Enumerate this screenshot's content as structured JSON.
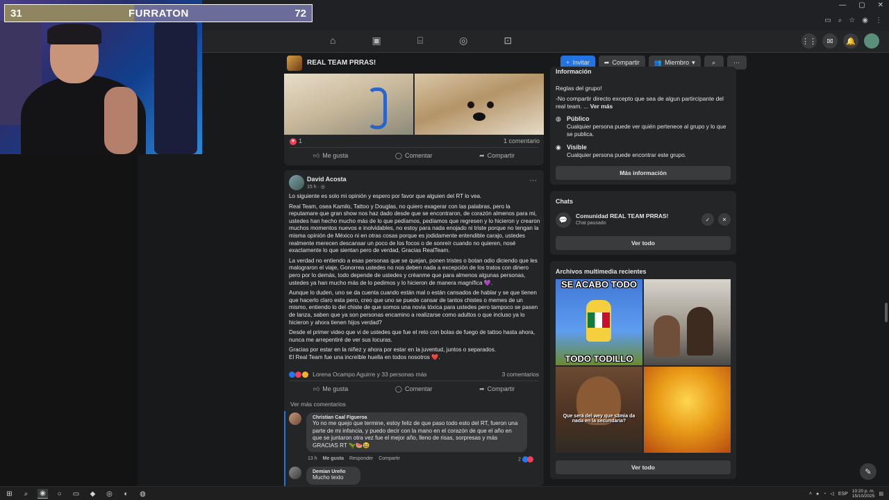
{
  "stream_overlay": {
    "left_score": "31",
    "title": "FURRATON",
    "right_score": "72"
  },
  "browser": {
    "window_controls": [
      "—",
      "▢",
      "✕"
    ]
  },
  "group": {
    "name": "REAL TEAM PRRAS!",
    "invite_label": "Invitar",
    "share_label": "Compartir",
    "member_label": "Miembro"
  },
  "post1": {
    "reaction_count": "1",
    "comments_count": "1 comentario",
    "like_label": "Me gusta",
    "comment_label": "Comentar",
    "share_label": "Compartir"
  },
  "post2": {
    "author": "David Acosta",
    "time": "15 h · ",
    "paragraphs": [
      "Lo siguiente es solo mi opinión y espero por favor que alguien del RT lo vea.",
      "Real Team, osea Kamilo, Tattoo y Douglas, no quiero exagerar con las palabras, pero la reputamare que gran show nos haz dado desde que se encontraron, de corazón almenos para mi, ustedes han hecho mucho más de lo que pedíamos, pedíamos que regresen y lo hicieron y crearon muchos momentos nuevos e inolvidables, no estoy para nada enojado ni triste porque no tengan la misma opinión de México ni en otras cosas porque es jodidamente entendible carajo, ustedes realmente merecen descansar un poco de los focos o de sonreír cuando no quieren, nosé exactamente lo que sientan pero de verdad, Gracias RealTeam.",
      "La verdad no entiendo a esas personas que se quejan, ponen tristes o botan odio diciendo que les malograron el viaje, Gonorrea ustedes no nos deben nada a excepción de los tratos con dinero pero por lo demás, todo depende de ustedes y créanme que para almenos algunas personas, ustedes ya han mucho más de lo pedimos y lo hicieron de manera magnífica 💜.",
      "Aunque lo duden, uno se da cuenta cuando están mal o están cansados de hablar y se que tienen que hacerlo claro esta pero, creo que uno se puede cansar de tantos chistes o memes de un mismo, entiendo lo del chiste de que somos una novia tóxica para ustedes pero tampoco se pasen de lanza, saben que ya son personas encamino a realizarse como adultos o que incluso ya lo hicieron y ahora tienen hijos verdad?",
      "Desde el primer video que vi de ustedes que fue el reto con bolas de fuego de tattoo hasta ahora, nunca me arrepentiré de ver sus locuras.",
      "Gracias por estar en la niñez y ahora por estar en la juventud, juntos o separados.\nEl Real Team fue una increíble huella en todos nosotros ❤️."
    ],
    "reactions_text": "Lorena Ocampo Aguirre y 33 personas más",
    "comments_count": "3 comentarios",
    "like_label": "Me gusta",
    "comment_label": "Comentar",
    "share_label": "Compartir",
    "see_more_comments": "Ver más comentarios"
  },
  "comments": [
    {
      "name": "Christian Caal Figueroa",
      "text": "Yo no me quejo que termine, estoy feliz de que paso todo esto del RT, fueron una parte de mi infancia, y puedo decir con la mano en el corazón de que el año en que se juntaron otra vez fue el mejor año, lleno de risas, sorpresas y más GRACIAS RT 🦖🍉😆",
      "time": "13 h",
      "like": "Me gusta",
      "reply": "Responder",
      "share": "Compartir",
      "reaction_count": "2"
    },
    {
      "name": "Demian Ureño",
      "text": "Mucho texto"
    }
  ],
  "sidebar": {
    "info_title": "Información",
    "rules_label": "Reglas del grupo!",
    "rules_text": "-No compartir directo excepto que sea de algun partircipante del real team. ...",
    "see_more": "Ver más",
    "public_title": "Público",
    "public_desc": "Cualquier persona puede ver quién pertenece al grupo y lo que se publica.",
    "visible_title": "Visible",
    "visible_desc": "Cualquier persona puede encontrar este grupo.",
    "more_info_button": "Más información",
    "chats_title": "Chats",
    "chat_name": "Comunidad REAL TEAM PRRAS!",
    "chat_status": "Chat pausado",
    "chats_see_all": "Ver todo",
    "media_title": "Archivos multimedia recientes",
    "media_see_all": "Ver todo",
    "memes": {
      "m1_top": "SE ACABO TODO",
      "m1_bottom": "TODO TODILLO",
      "m3_mid": "Que será del wey que s3mia da nada en la secundaria?"
    }
  },
  "taskbar": {
    "lang": "ESP",
    "time": "10:20 p. m.",
    "date": "15/10/2025"
  },
  "colors": {
    "accent": "#2374e1",
    "background": "#18191a",
    "card": "#242526"
  }
}
